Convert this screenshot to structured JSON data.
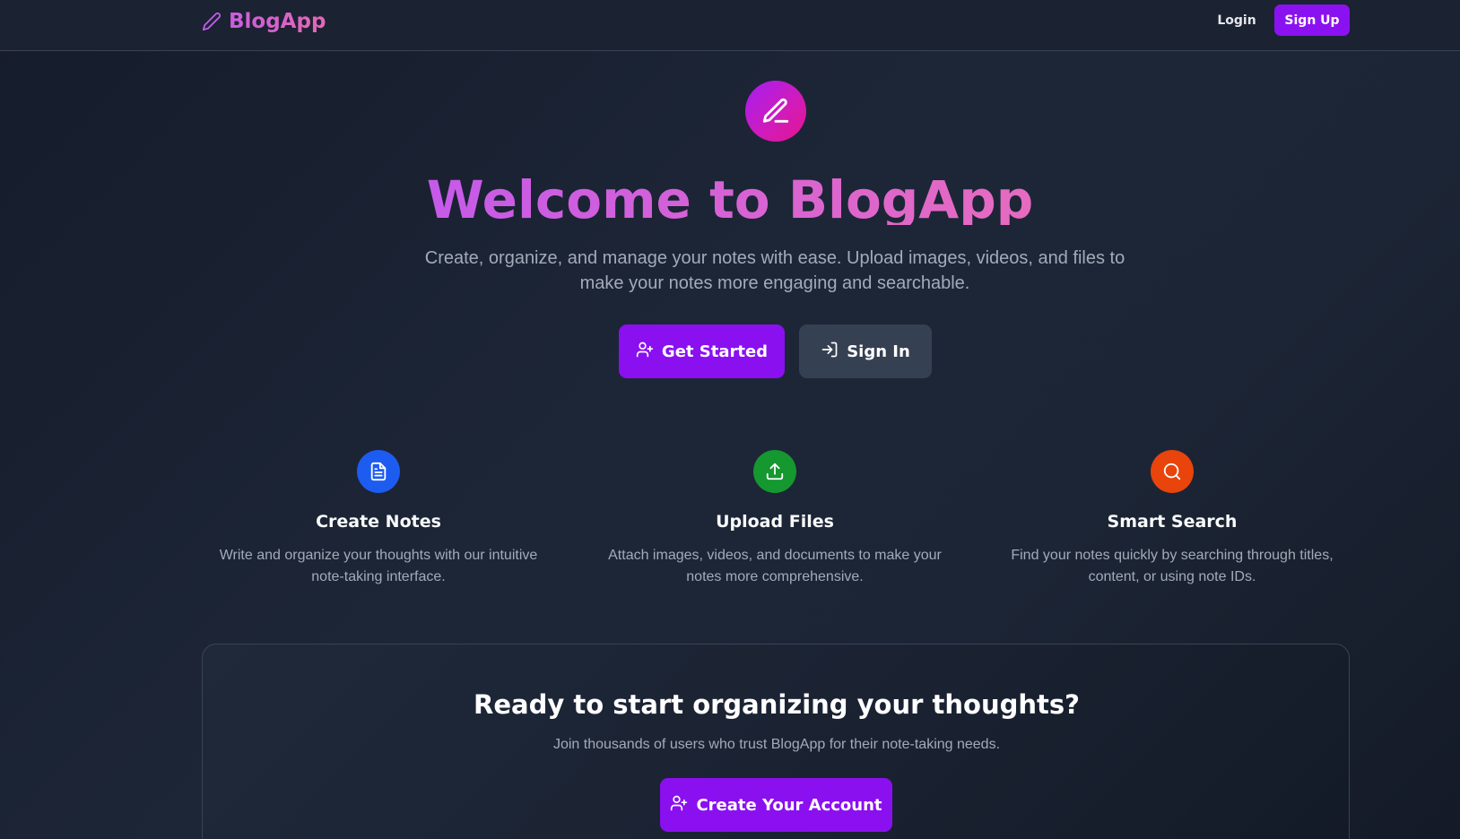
{
  "navbar": {
    "brand": "BlogApp",
    "brand_icon": "pencil-icon",
    "login_label": "Login",
    "signup_label": "Sign Up"
  },
  "hero": {
    "icon": "pencil-icon",
    "title": "Welcome to BlogApp",
    "subtitle": "Create, organize, and manage your notes with ease. Upload images, videos, and files to make your notes more engaging and searchable.",
    "get_started_label": "Get Started",
    "get_started_icon": "user-plus-icon",
    "sign_in_label": "Sign In",
    "sign_in_icon": "log-in-icon"
  },
  "features": [
    {
      "title": "Create Notes",
      "description": "Write and organize your thoughts with our intuitive note-taking interface.",
      "icon": "document-icon",
      "color": "#1d5cf0"
    },
    {
      "title": "Upload Files",
      "description": "Attach images, videos, and documents to make your notes more comprehensive.",
      "icon": "upload-icon",
      "color": "#14982f"
    },
    {
      "title": "Smart Search",
      "description": "Find your notes quickly by searching through titles, content, or using note IDs.",
      "icon": "search-icon",
      "color": "#e8440c"
    }
  ],
  "cta": {
    "title": "Ready to start organizing your thoughts?",
    "subtitle": "Join thousands of users who trust BlogApp for their note-taking needs.",
    "button_label": "Create Your Account",
    "button_icon": "user-plus-icon"
  },
  "colors": {
    "accent": "#8b12f0",
    "background": "#1c2535"
  }
}
